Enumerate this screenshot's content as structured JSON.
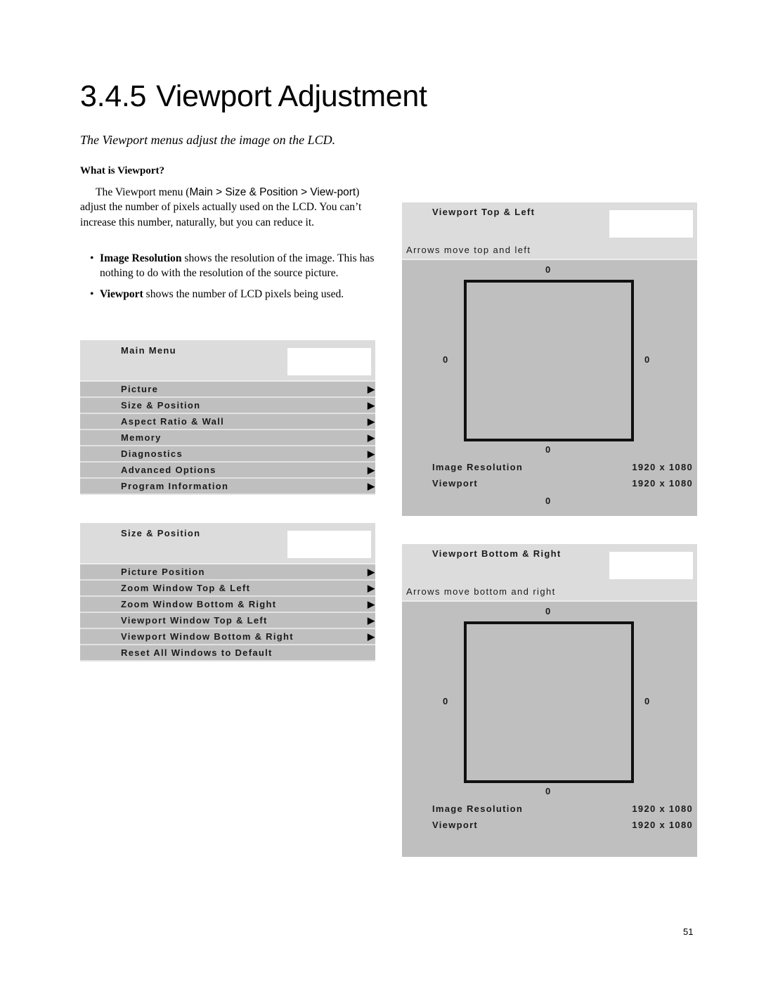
{
  "page": {
    "section_number": "3.4.5",
    "title": "Viewport Adjustment",
    "subtitle": "The Viewport menus adjust the image on the LCD.",
    "heading": "What is Viewport?",
    "paragraph": {
      "part1": "The Viewport menu (",
      "path": "Main > Size & Position > View-port",
      "part2": ") adjust the number of pixels actually used on the LCD. You can’t increase this number, naturally, but you can reduce it."
    },
    "bullets": [
      {
        "bold": "Image",
        "bold_rest": " Resolution",
        "text": " shows the resolution of the image. This has nothing to do with the resolution of the source picture."
      },
      {
        "bold": "Viewport",
        "bold_rest": "",
        "text": " shows the number of LCD pixels being used."
      }
    ],
    "bullet_glyph": "•",
    "page_number": "51"
  },
  "main_menu": {
    "title": "Main Menu",
    "items": [
      {
        "label": "Picture",
        "arrow": "▶"
      },
      {
        "label": "Size & Position",
        "arrow": "▶"
      },
      {
        "label": "Aspect Ratio & Wall",
        "arrow": "▶"
      },
      {
        "label": "Memory",
        "arrow": "▶"
      },
      {
        "label": "Diagnostics",
        "arrow": "▶"
      },
      {
        "label": "Advanced Options",
        "arrow": "▶"
      },
      {
        "label": "Program Information",
        "arrow": "▶"
      }
    ]
  },
  "size_position_menu": {
    "title": "Size & Position",
    "items": [
      {
        "label": "Picture Position",
        "arrow": "▶"
      },
      {
        "label": "Zoom Window Top & Left",
        "arrow": "▶"
      },
      {
        "label": "Zoom Window Bottom & Right",
        "arrow": "▶"
      },
      {
        "label": "Viewport Window Top & Left",
        "arrow": "▶"
      },
      {
        "label": "Viewport Window Bottom & Right",
        "arrow": "▶"
      },
      {
        "label": "Reset All Windows to Default",
        "arrow": ""
      }
    ]
  },
  "viewport_top_left": {
    "title": "Viewport Top & Left",
    "hint": "Arrows move top and left",
    "top": "0",
    "left": "0",
    "right": "0",
    "bottom": "0",
    "image_resolution_label": "Image Resolution",
    "image_resolution_value": "1920 x 1080",
    "viewport_label": "Viewport",
    "viewport_value": "1920 x 1080",
    "footer_value": "0"
  },
  "viewport_bottom_right": {
    "title": "Viewport Bottom & Right",
    "hint": "Arrows move bottom and right",
    "top": "0",
    "left": "0",
    "right": "0",
    "bottom": "0",
    "image_resolution_label": "Image Resolution",
    "image_resolution_value": "1920 x 1080",
    "viewport_label": "Viewport",
    "viewport_value": "1920 x 1080"
  }
}
